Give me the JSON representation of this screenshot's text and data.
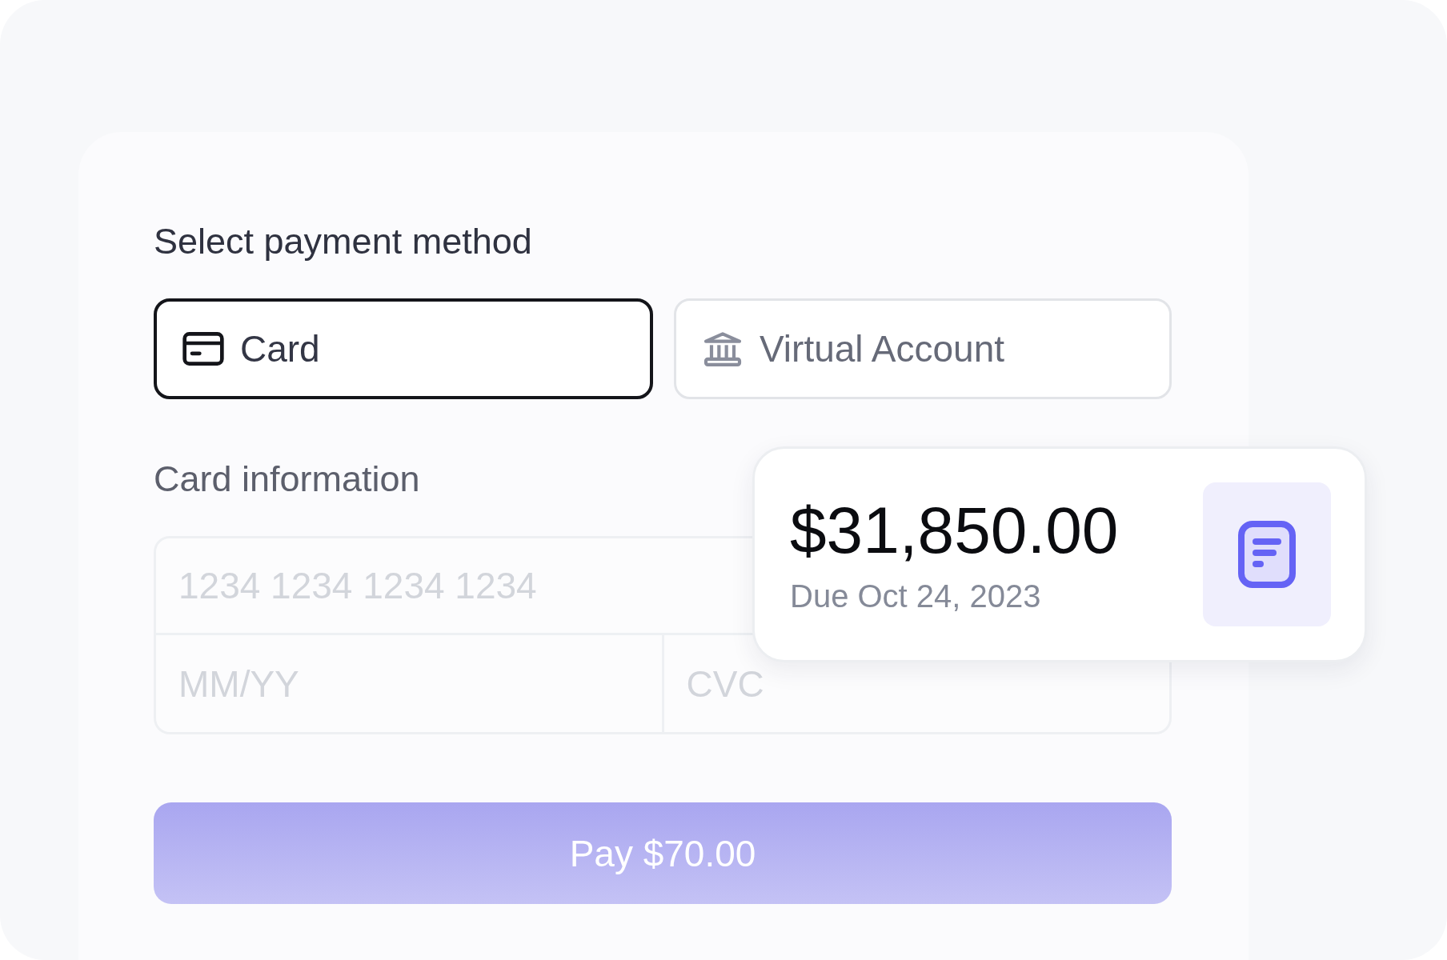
{
  "title": "Select payment method",
  "methods": [
    {
      "label": "Card",
      "kind": "card",
      "selected": true
    },
    {
      "label": "Virtual Account",
      "kind": "bank",
      "selected": false
    }
  ],
  "card_info": {
    "title": "Card information",
    "number": {
      "placeholder": "1234 1234 1234 1234"
    },
    "expiry": {
      "placeholder": "MM/YY"
    },
    "cvc": {
      "placeholder": "CVC"
    }
  },
  "pay_button": {
    "label": "Pay $70.00",
    "disabled": true
  },
  "invoice": {
    "amount": "$31,850.00",
    "due": "Due Oct 24, 2023"
  }
}
